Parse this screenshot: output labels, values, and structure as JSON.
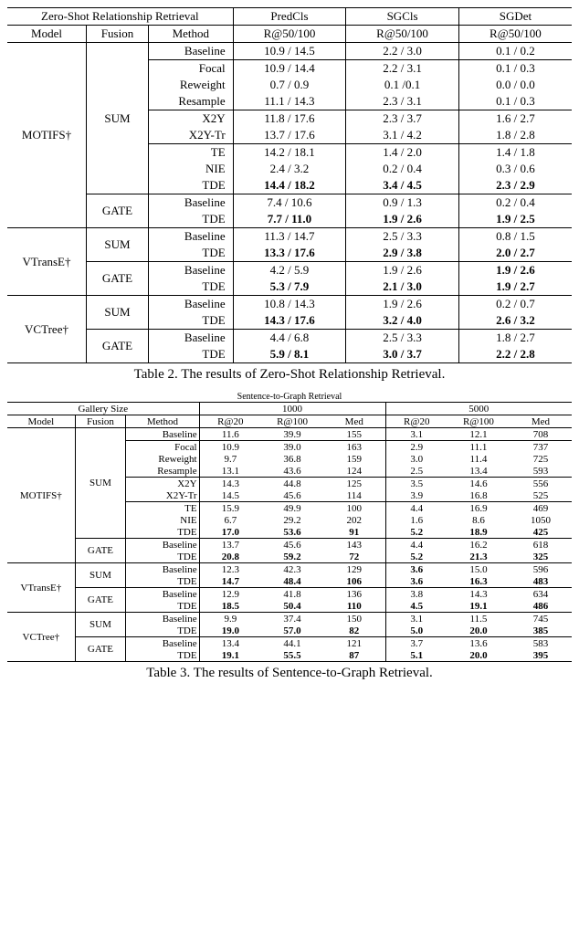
{
  "table2": {
    "header_row1": {
      "spanner": "Zero-Shot Relationship Retrieval",
      "col_predcls": "PredCls",
      "col_sgcls": "SGCls",
      "col_sgdet": "SGDet"
    },
    "header_row2": {
      "model": "Model",
      "fusion": "Fusion",
      "method": "Method",
      "r_predcls": "R@50/100",
      "r_sgcls": "R@50/100",
      "r_sgdet": "R@50/100"
    },
    "motifs": {
      "model": "MOTIFS†",
      "sum": "SUM",
      "gate": "GATE",
      "rows_sum": [
        {
          "method": "Baseline",
          "p": "10.9 / 14.5",
          "s": "2.2 / 3.0",
          "d": "0.1 / 0.2",
          "bold": false
        },
        {
          "method": "Focal",
          "p": "10.9 / 14.4",
          "s": "2.2 / 3.1",
          "d": "0.1 / 0.3",
          "bold": false
        },
        {
          "method": "Reweight",
          "p": "0.7 / 0.9",
          "s": "0.1 /0.1",
          "d": "0.0 / 0.0",
          "bold": false
        },
        {
          "method": "Resample",
          "p": "11.1 / 14.3",
          "s": "2.3 / 3.1",
          "d": "0.1 / 0.3",
          "bold": false
        },
        {
          "method": "X2Y",
          "p": "11.8 / 17.6",
          "s": "2.3 / 3.7",
          "d": "1.6 / 2.7",
          "bold": false
        },
        {
          "method": "X2Y-Tr",
          "p": "13.7 / 17.6",
          "s": "3.1 / 4.2",
          "d": "1.8 / 2.8",
          "bold": false
        },
        {
          "method": "TE",
          "p": "14.2 / 18.1",
          "s": "1.4 / 2.0",
          "d": "1.4 / 1.8",
          "bold": false
        },
        {
          "method": "NIE",
          "p": "2.4 / 3.2",
          "s": "0.2 / 0.4",
          "d": "0.3 / 0.6",
          "bold": false
        },
        {
          "method": "TDE",
          "p": "14.4 / 18.2",
          "s": "3.4 / 4.5",
          "d": "2.3 / 2.9",
          "bold": true
        }
      ],
      "rows_gate": [
        {
          "method": "Baseline",
          "p": "7.4 / 10.6",
          "s": "0.9 / 1.3",
          "d": "0.2 / 0.4",
          "bold": false
        },
        {
          "method": "TDE",
          "p": "7.7 / 11.0",
          "s": "1.9 / 2.6",
          "d": "1.9 / 2.5",
          "bold": true
        }
      ]
    },
    "vtranse": {
      "model": "VTransE†",
      "sum": "SUM",
      "gate": "GATE",
      "rows_sum": [
        {
          "method": "Baseline",
          "p": "11.3 / 14.7",
          "s": "2.5 / 3.3",
          "d": "0.8 / 1.5",
          "bold": false
        },
        {
          "method": "TDE",
          "p": "13.3 / 17.6",
          "s": "2.9 / 3.8",
          "d": "2.0 / 2.7",
          "bold": true
        }
      ],
      "rows_gate": [
        {
          "method": "Baseline",
          "p": "4.2 / 5.9",
          "s": "1.9 / 2.6",
          "d": "1.9 / 2.6",
          "bold_d": true
        },
        {
          "method": "TDE",
          "p": "5.3 / 7.9",
          "s": "2.1 / 3.0",
          "d": "1.9 / 2.7",
          "bold": true
        }
      ]
    },
    "vctree": {
      "model": "VCTree†",
      "sum": "SUM",
      "gate": "GATE",
      "rows_sum": [
        {
          "method": "Baseline",
          "p": "10.8 / 14.3",
          "s": "1.9 / 2.6",
          "d": "0.2 / 0.7",
          "bold": false
        },
        {
          "method": "TDE",
          "p": "14.3 / 17.6",
          "s": "3.2 / 4.0",
          "d": "2.6 / 3.2",
          "bold": true
        }
      ],
      "rows_gate": [
        {
          "method": "Baseline",
          "p": "4.4 / 6.8",
          "s": "2.5 / 3.3",
          "d": "1.8 / 2.7",
          "bold": false
        },
        {
          "method": "TDE",
          "p": "5.9 / 8.1",
          "s": "3.0 / 3.7",
          "d": "2.2 / 2.8",
          "bold": true
        }
      ]
    },
    "caption": "Table 2. The results of Zero-Shot Relationship Retrieval."
  },
  "table3": {
    "subtitle": "Sentence-to-Graph Retrieval",
    "header_row1": {
      "gallery": "Gallery Size",
      "g1000": "1000",
      "g5000": "5000"
    },
    "header_row2": {
      "model": "Model",
      "fusion": "Fusion",
      "method": "Method",
      "r20": "R@20",
      "r100": "R@100",
      "med": "Med",
      "r20b": "R@20",
      "r100b": "R@100",
      "medb": "Med"
    },
    "motifs": {
      "model": "MOTIFS†",
      "sum": "SUM",
      "gate": "GATE",
      "rows_sum": [
        {
          "method": "Baseline",
          "a": "11.6",
          "b": "39.9",
          "c": "155",
          "d": "3.1",
          "e": "12.1",
          "f": "708"
        },
        {
          "method": "Focal",
          "a": "10.9",
          "b": "39.0",
          "c": "163",
          "d": "2.9",
          "e": "11.1",
          "f": "737"
        },
        {
          "method": "Reweight",
          "a": "9.7",
          "b": "36.8",
          "c": "159",
          "d": "3.0",
          "e": "11.4",
          "f": "725"
        },
        {
          "method": "Resample",
          "a": "13.1",
          "b": "43.6",
          "c": "124",
          "d": "2.5",
          "e": "13.4",
          "f": "593"
        },
        {
          "method": "X2Y",
          "a": "14.3",
          "b": "44.8",
          "c": "125",
          "d": "3.5",
          "e": "14.6",
          "f": "556"
        },
        {
          "method": "X2Y-Tr",
          "a": "14.5",
          "b": "45.6",
          "c": "114",
          "d": "3.9",
          "e": "16.8",
          "f": "525"
        },
        {
          "method": "TE",
          "a": "15.9",
          "b": "49.9",
          "c": "100",
          "d": "4.4",
          "e": "16.9",
          "f": "469"
        },
        {
          "method": "NIE",
          "a": "6.7",
          "b": "29.2",
          "c": "202",
          "d": "1.6",
          "e": "8.6",
          "f": "1050"
        },
        {
          "method": "TDE",
          "a": "17.0",
          "b": "53.6",
          "c": "91",
          "d": "5.2",
          "e": "18.9",
          "f": "425",
          "bold": true
        }
      ],
      "rows_gate": [
        {
          "method": "Baseline",
          "a": "13.7",
          "b": "45.6",
          "c": "143",
          "d": "4.4",
          "e": "16.2",
          "f": "618"
        },
        {
          "method": "TDE",
          "a": "20.8",
          "b": "59.2",
          "c": "72",
          "d": "5.2",
          "e": "21.3",
          "f": "325",
          "bold": true
        }
      ]
    },
    "vtranse": {
      "model": "VTransE†",
      "sum": "SUM",
      "gate": "GATE",
      "rows_sum": [
        {
          "method": "Baseline",
          "a": "12.3",
          "b": "42.3",
          "c": "129",
          "d": "3.6",
          "e": "15.0",
          "f": "596",
          "bold_d": true
        },
        {
          "method": "TDE",
          "a": "14.7",
          "b": "48.4",
          "c": "106",
          "d": "3.6",
          "e": "16.3",
          "f": "483",
          "bold": true
        }
      ],
      "rows_gate": [
        {
          "method": "Baseline",
          "a": "12.9",
          "b": "41.8",
          "c": "136",
          "d": "3.8",
          "e": "14.3",
          "f": "634"
        },
        {
          "method": "TDE",
          "a": "18.5",
          "b": "50.4",
          "c": "110",
          "d": "4.5",
          "e": "19.1",
          "f": "486",
          "bold": true
        }
      ]
    },
    "vctree": {
      "model": "VCTree†",
      "sum": "SUM",
      "gate": "GATE",
      "rows_sum": [
        {
          "method": "Baseline",
          "a": "9.9",
          "b": "37.4",
          "c": "150",
          "d": "3.1",
          "e": "11.5",
          "f": "745"
        },
        {
          "method": "TDE",
          "a": "19.0",
          "b": "57.0",
          "c": "82",
          "d": "5.0",
          "e": "20.0",
          "f": "385",
          "bold": true
        }
      ],
      "rows_gate": [
        {
          "method": "Baseline",
          "a": "13.4",
          "b": "44.1",
          "c": "121",
          "d": "3.7",
          "e": "13.6",
          "f": "583"
        },
        {
          "method": "TDE",
          "a": "19.1",
          "b": "55.5",
          "c": "87",
          "d": "5.1",
          "e": "20.0",
          "f": "395",
          "bold": true
        }
      ]
    },
    "caption": "Table 3. The results of Sentence-to-Graph Retrieval."
  }
}
